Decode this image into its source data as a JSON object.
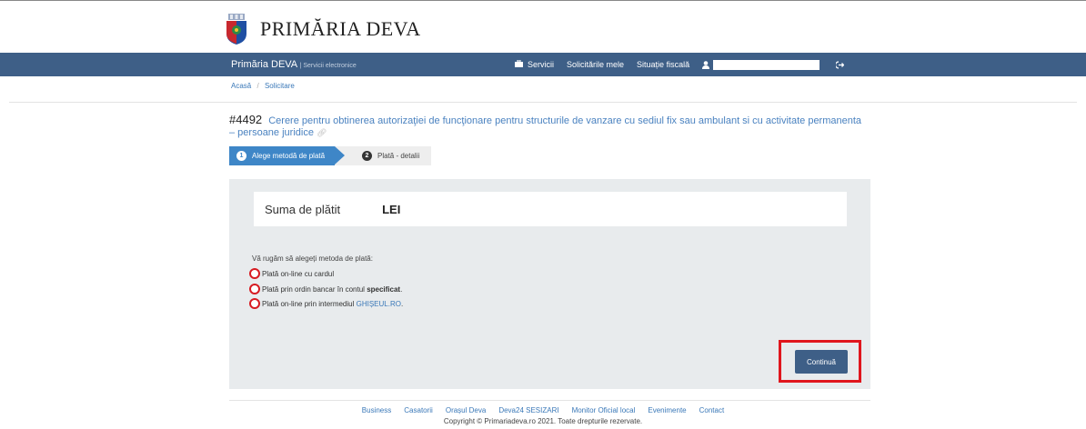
{
  "header": {
    "logo_text": "PRIMĂRIA DEVA",
    "colors": {
      "navbar": "#3e5f87",
      "accent": "#3e86c7",
      "highlight": "#e0161d"
    }
  },
  "navbar": {
    "brand": "Primăria DEVA",
    "brand_sub": "| Servicii electronice",
    "items": [
      {
        "icon": "briefcase-icon",
        "label": "Servicii"
      },
      {
        "label": "Solicitările mele"
      },
      {
        "label": "Situație fiscală"
      }
    ],
    "user_icon": "user-icon",
    "logout_icon": "logout-icon"
  },
  "breadcrumb": {
    "items": [
      "Acasă",
      "Solicitare"
    ]
  },
  "request": {
    "number": "#4492",
    "title": "Cerere pentru obtinerea autorizaţiei de funcţionare pentru structurile de vanzare cu sediul fix sau ambulant si cu activitate permanenta – persoane juridice"
  },
  "steps": [
    {
      "num": "1",
      "label": "Alege metodă de plată"
    },
    {
      "num": "2",
      "label": "Plată - detalii"
    }
  ],
  "payment": {
    "sum_label": "Suma de plătit",
    "sum_value": "LEI",
    "prompt": "Vă rugăm să alegeți metoda de plată:",
    "options": [
      {
        "text": "Plată on-line cu cardul"
      },
      {
        "text": "Plată prin ordin bancar în contul ",
        "bold": "specificat",
        "suffix": "."
      },
      {
        "text": "Plată on-line prin intermediul ",
        "link": "GHIȘEUL.RO",
        "suffix": "."
      }
    ],
    "continue_label": "Continuă"
  },
  "footer": {
    "links": [
      "Business",
      "Casatorii",
      "Orașul Deva",
      "Deva24 SESIZARI",
      "Monitor Oficial local",
      "Evenimente",
      "Contact"
    ],
    "copyright": "Copyright © Primariadeva.ro 2021. Toate drepturile rezervate."
  }
}
